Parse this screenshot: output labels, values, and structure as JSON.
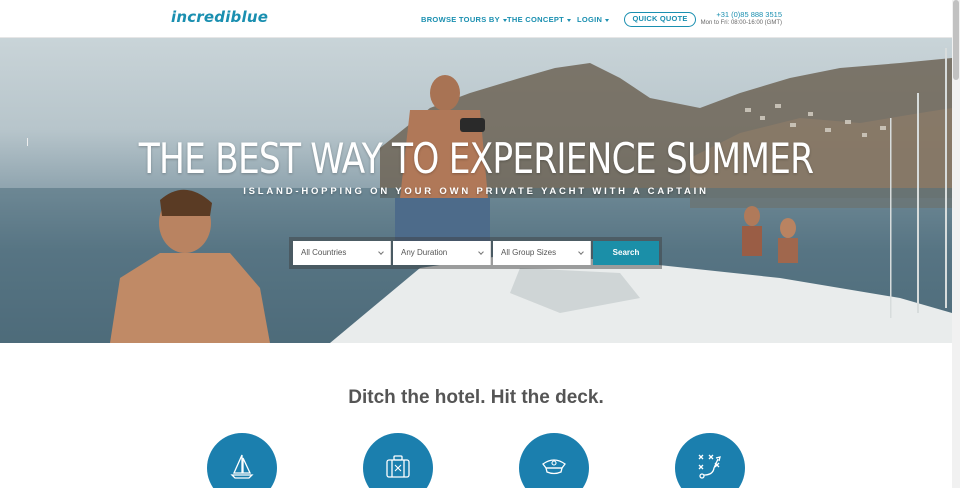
{
  "header": {
    "logo": "incrediblue",
    "nav": [
      {
        "label": "BROWSE TOURS BY",
        "has_dropdown": true
      },
      {
        "label": "THE CONCEPT",
        "has_dropdown": true
      },
      {
        "label": "LOGIN",
        "has_dropdown": true
      }
    ],
    "quick_quote": "QUICK QUOTE",
    "phone": "+31 (0)85 888 3515",
    "hours": "Mon to Fri: 08:00-16:00 (GMT)"
  },
  "hero": {
    "title": "THE BEST WAY TO EXPERIENCE SUMMER",
    "subtitle": "ISLAND-HOPPING ON YOUR OWN PRIVATE YACHT WITH A CAPTAIN",
    "search": {
      "country": "All Countries",
      "duration": "Any Duration",
      "group_size": "All Group Sizes",
      "button": "Search"
    }
  },
  "section": {
    "tagline": "Ditch the hotel. Hit the deck.",
    "features": [
      {
        "icon": "sailboat-icon"
      },
      {
        "icon": "luggage-icon"
      },
      {
        "icon": "captain-hat-icon"
      },
      {
        "icon": "route-plan-icon"
      }
    ]
  },
  "colors": {
    "brand": "#1a8fb0",
    "search_button": "#1b8fa8",
    "feature_circle": "#1b7fae"
  }
}
